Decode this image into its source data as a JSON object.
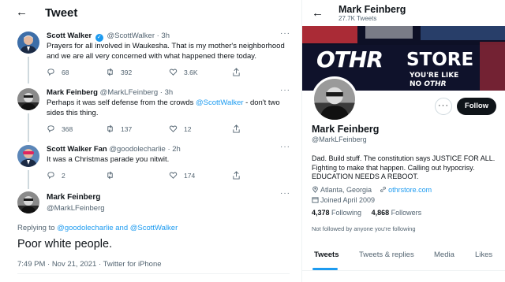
{
  "colors": {
    "accent": "#1d9bf0",
    "text": "#0f1419",
    "muted": "#536471",
    "follow_bg": "#0f1419",
    "banner_bg": "#0d1026"
  },
  "left": {
    "title": "Tweet",
    "back_icon": "arrow-left-icon",
    "tweets": [
      {
        "name": "Scott Walker",
        "verified": true,
        "handle": "@ScottWalker",
        "time": "· 3h",
        "text": "Prayers for all involved in Waukesha. That is my mother's neighborhood and we are all very concerned with what happened there today.",
        "replies": "68",
        "retweets": "392",
        "likes": "3.6K"
      },
      {
        "name": "Mark Feinberg",
        "handle": "@MarkLFeinberg",
        "time": "· 3h",
        "text_before": "Perhaps it was self defense from the crowds ",
        "mention": "@ScottWalker",
        "text_after": " - don't two sides this thing.",
        "replies": "368",
        "retweets": "137",
        "likes": "12"
      },
      {
        "name": "Scott Walker Fan",
        "handle": "@goodolecharlie",
        "time": "· 2h",
        "text": "It was a Christmas parade you nitwit.",
        "replies": "2",
        "retweets": "",
        "likes": "174"
      }
    ],
    "main": {
      "name": "Mark Feinberg",
      "handle": "@MarkLFeinberg",
      "replying_prefix": "Replying to ",
      "replying_to": "@goodolecharlie and @ScottWalker",
      "text": "Poor white people.",
      "meta": "7:49 PM · Nov 21, 2021 · Twitter for iPhone"
    }
  },
  "right": {
    "header_name": "Mark Feinberg",
    "tweet_count": "27.7K Tweets",
    "banner": {
      "brand": "OTHR",
      "store": "STORE",
      "line1": "YOU'RE LIKE",
      "line2_prefix": "NO ",
      "line2_brand": "OTHR"
    },
    "follow_label": "Follow",
    "more_label": "···",
    "name": "Mark Feinberg",
    "handle": "@MarkLFeinberg",
    "bio": "Dad. Build stuff. The constitution says JUSTICE FOR ALL. Fighting to make that happen. Calling out hypocrisy. EDUCATION NEEDS A REBOOT.",
    "location": "Atlanta, Georgia",
    "website": "othrstore.com",
    "joined": "Joined April 2009",
    "following_count": "4,378",
    "following_label": "Following",
    "followers_count": "4,868",
    "followers_label": "Followers",
    "not_followed": "Not followed by anyone you're following",
    "tabs": [
      "Tweets",
      "Tweets & replies",
      "Media",
      "Likes"
    ],
    "active_tab": "Tweets"
  }
}
